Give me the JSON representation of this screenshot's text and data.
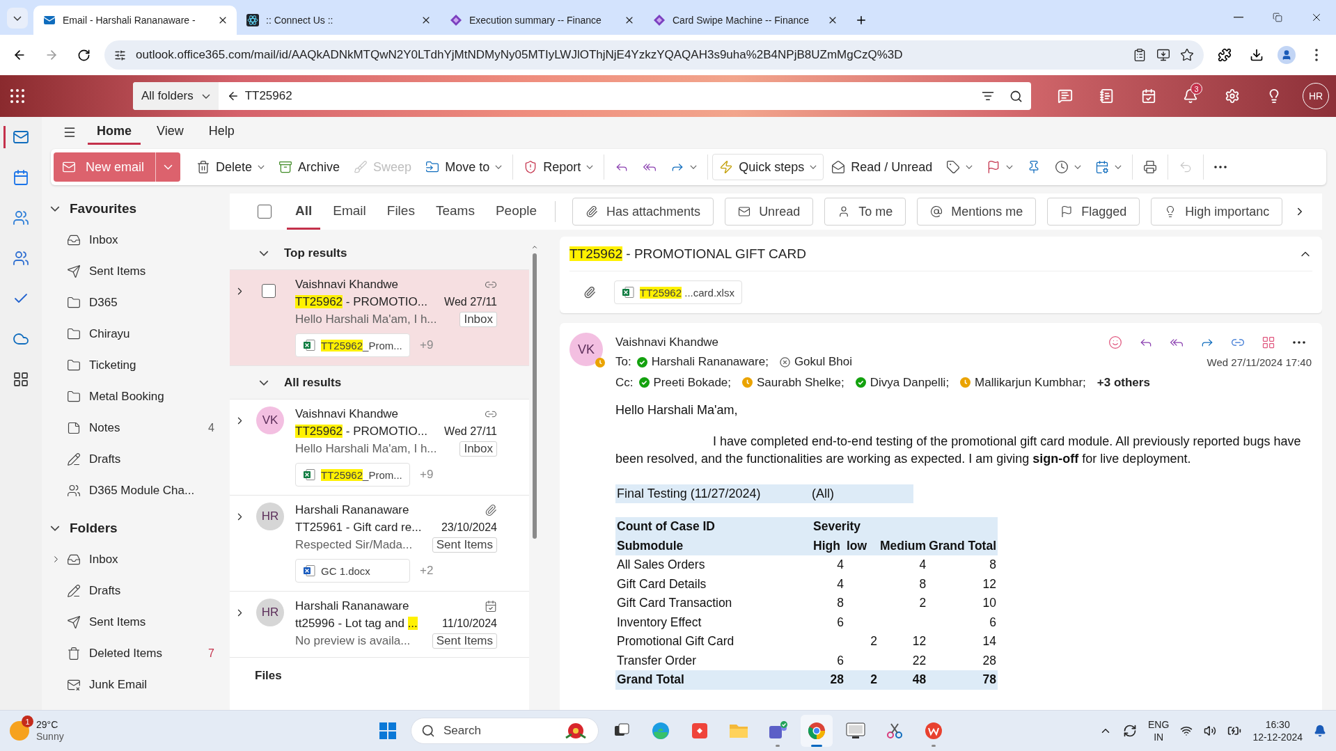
{
  "browser": {
    "tabs": [
      {
        "kind": "mail",
        "title": "Email - Harshali Rananaware -",
        "selected": true
      },
      {
        "kind": "atom",
        "title": ":: Connect Us ::",
        "selected": false
      },
      {
        "kind": "diamond",
        "title": "Execution summary -- Finance",
        "selected": false
      },
      {
        "kind": "diamond",
        "title": "Card Swipe Machine -- Finance",
        "selected": false
      }
    ],
    "url": "outlook.office365.com/mail/id/AAQkADNkMTQwN2Y0LTdhYjMtNDMyNy05MTIyLWJlOThjNjE4YzkzYQAQAH3s9uha%2B4NPjB8UZmMgCzQ%3D"
  },
  "header": {
    "scope": "All folders",
    "search": "TT25962",
    "notifications": "3",
    "avatar": "HR"
  },
  "rail": [
    {
      "kind": "mail",
      "selected": true
    },
    {
      "kind": "calendar",
      "selected": false
    },
    {
      "kind": "people",
      "selected": false
    },
    {
      "kind": "groups",
      "selected": false
    },
    {
      "kind": "todo",
      "selected": false
    },
    {
      "kind": "cloud",
      "selected": false
    },
    {
      "kind": "apps",
      "selected": false
    }
  ],
  "ribbon": {
    "tabs": [
      {
        "label": "Home",
        "selected": true
      },
      {
        "label": "View",
        "selected": false
      },
      {
        "label": "Help",
        "selected": false
      }
    ],
    "new_email": "New email",
    "groups": [
      [
        {
          "kind": "delete",
          "label": "Delete",
          "dropdown": true,
          "disabled": false
        },
        {
          "kind": "archive",
          "label": "Archive",
          "dropdown": false,
          "disabled": false
        },
        {
          "kind": "sweep",
          "label": "Sweep",
          "dropdown": false,
          "disabled": true
        },
        {
          "kind": "move",
          "label": "Move to",
          "dropdown": true,
          "disabled": false
        }
      ],
      [
        {
          "kind": "report",
          "label": "Report",
          "dropdown": true,
          "disabled": false
        }
      ],
      [
        {
          "kind": "reply",
          "dropdown": false,
          "disabled": false
        },
        {
          "kind": "reply_all",
          "dropdown": false,
          "disabled": false
        },
        {
          "kind": "forward",
          "dropdown": true,
          "disabled": false
        }
      ],
      [
        {
          "kind": "quick_steps",
          "label": "Quick steps",
          "dropdown": true,
          "disabled": false
        },
        {
          "kind": "read",
          "label": "Read / Unread",
          "dropdown": false,
          "disabled": false
        },
        {
          "kind": "tag",
          "dropdown": true,
          "disabled": false
        },
        {
          "kind": "flag",
          "dropdown": true,
          "disabled": false
        },
        {
          "kind": "pin",
          "dropdown": false,
          "disabled": false
        },
        {
          "kind": "snooze",
          "dropdown": true,
          "disabled": false
        },
        {
          "kind": "rules",
          "dropdown": true,
          "disabled": false
        }
      ],
      [
        {
          "kind": "print",
          "dropdown": false,
          "disabled": false
        }
      ],
      [
        {
          "kind": "undo",
          "dropdown": false,
          "disabled": true
        }
      ],
      [
        {
          "kind": "more",
          "dropdown": false,
          "disabled": false
        }
      ]
    ]
  },
  "favourites": {
    "title": "Favourites",
    "expanded": true,
    "items": [
      {
        "kind": "inbox",
        "label": "Inbox"
      },
      {
        "kind": "sent",
        "label": "Sent Items"
      },
      {
        "kind": "folder",
        "label": "D365"
      },
      {
        "kind": "folder",
        "label": "Chirayu"
      },
      {
        "kind": "folder",
        "label": "Ticketing"
      },
      {
        "kind": "folder",
        "label": "Metal Booking"
      },
      {
        "kind": "notes",
        "label": "Notes",
        "count": {
          "text": "4",
          "unread": false
        }
      },
      {
        "kind": "drafts",
        "label": "Drafts"
      },
      {
        "kind": "group",
        "label": "D365 Module Cha..."
      }
    ]
  },
  "folders": {
    "title": "Folders",
    "expanded": true,
    "items": [
      {
        "kind": "inbox",
        "label": "Inbox",
        "expandable": true
      },
      {
        "kind": "drafts",
        "label": "Drafts",
        "expandable": false
      },
      {
        "kind": "sent",
        "label": "Sent Items",
        "expandable": false
      },
      {
        "kind": "deleted",
        "label": "Deleted Items",
        "expandable": false,
        "count": {
          "text": "7",
          "unread": true
        }
      },
      {
        "kind": "junk",
        "label": "Junk Email",
        "expandable": false
      }
    ]
  },
  "filter_bar": {
    "select_all": false,
    "tabs": [
      {
        "label": "All",
        "selected": true
      },
      {
        "label": "Email",
        "selected": false
      },
      {
        "label": "Files",
        "selected": false
      },
      {
        "label": "Teams",
        "selected": false
      },
      {
        "label": "People",
        "selected": false
      }
    ],
    "chips": [
      {
        "kind": "attachment",
        "label": "Has attachments"
      },
      {
        "kind": "unread",
        "label": "Unread"
      },
      {
        "kind": "person",
        "label": "To me"
      },
      {
        "kind": "mention",
        "label": "Mentions me"
      },
      {
        "kind": "flag",
        "label": "Flagged"
      },
      {
        "kind": "importance",
        "label": "High importanc"
      }
    ]
  },
  "results": [
    {
      "title": "Top results",
      "expanded": true,
      "messages": [
        {
          "lead": {
            "kind": "checkbox",
            "checked": false
          },
          "selected": true,
          "sender": "Vaishnavi Khandwe",
          "status": {
            "kind": "link"
          },
          "subject": [
            {
              "text": "TT25962",
              "highlighted": true
            },
            {
              "text": " - PROMOTIO...",
              "highlighted": false
            }
          ],
          "date": "Wed 27/11",
          "preview": "Hello Harshali Ma'am, I h...",
          "folder": "Inbox",
          "attachment": {
            "kind": "excel",
            "name": [
              {
                "text": "TT25962",
                "highlighted": true
              },
              {
                "text": "_Prom...",
                "highlighted": false
              }
            ],
            "more": "+9"
          }
        }
      ]
    },
    {
      "title": "All results",
      "expanded": true,
      "messages": [
        {
          "lead": {
            "kind": "avatar",
            "initials": "VK",
            "color": "#f3bfe1"
          },
          "selected": false,
          "sender": "Vaishnavi Khandwe",
          "status": {
            "kind": "link"
          },
          "subject": [
            {
              "text": "TT25962",
              "highlighted": true
            },
            {
              "text": " - PROMOTIO...",
              "highlighted": false
            }
          ],
          "date": "Wed 27/11",
          "preview": "Hello Harshali Ma'am, I h...",
          "folder": "Inbox",
          "attachment": {
            "kind": "excel",
            "name": [
              {
                "text": "TT25962",
                "highlighted": true
              },
              {
                "text": "_Prom...",
                "highlighted": false
              }
            ],
            "more": "+9"
          }
        },
        {
          "lead": {
            "kind": "avatar",
            "initials": "HR",
            "color": "#d6d6d6"
          },
          "selected": false,
          "sender": "Harshali Rananaware",
          "status": {
            "kind": "paperclip"
          },
          "subject": [
            {
              "text": "TT25961 - Gift card re...",
              "highlighted": false
            }
          ],
          "date": "23/10/2024",
          "preview": "Respected Sir/Mada...",
          "folder": "Sent Items",
          "attachment": {
            "kind": "word",
            "name": [
              {
                "text": "GC 1.docx",
                "highlighted": false
              }
            ],
            "more": "+2"
          }
        },
        {
          "lead": {
            "kind": "avatar",
            "initials": "HR",
            "color": "#d6d6d6"
          },
          "selected": false,
          "sender": "Harshali Rananaware",
          "status": {
            "kind": "calendar"
          },
          "subject": [
            {
              "text": "tt25996 - Lot tag and ",
              "highlighted": false
            },
            {
              "text": "...",
              "highlighted": true
            }
          ],
          "date": "11/10/2024",
          "preview": "No preview is availa...",
          "folder": "Sent Items"
        }
      ]
    }
  ],
  "files_heading": "Files",
  "reading": {
    "subject": [
      {
        "text": "TT25962",
        "highlighted": true
      },
      {
        "text": " - PROMOTIONAL GIFT CARD",
        "highlighted": false
      }
    ],
    "attachments": [
      {
        "kind": "excel",
        "name": [
          {
            "text": "TT25962",
            "highlighted": true
          },
          {
            "text": " ...card.xlsx",
            "highlighted": false
          }
        ]
      }
    ],
    "message": {
      "avatar": {
        "initials": "VK",
        "color": "#f3bfe1"
      },
      "presence": {
        "kind": "away"
      },
      "sender": "Vaishnavi Khandwe",
      "to_label": "To:",
      "to": [
        {
          "name": "Harshali Rananaware;",
          "presence": {
            "kind": "available"
          }
        },
        {
          "name": "Gokul Bhoi",
          "presence": {
            "kind": "offline"
          }
        }
      ],
      "cc_label": "Cc:",
      "cc": [
        {
          "name": "Preeti Bokade;",
          "presence": {
            "kind": "available"
          }
        },
        {
          "name": "Saurabh Shelke;",
          "presence": {
            "kind": "away"
          }
        },
        {
          "name": "Divya Danpelli;",
          "presence": {
            "kind": "available"
          }
        },
        {
          "name": "Mallikarjun Kumbhar;",
          "presence": {
            "kind": "away"
          }
        }
      ],
      "others": "+3 others",
      "date": "Wed 27/11/2024 17:40",
      "greeting": "Hello Harshali Ma'am,",
      "paragraph": "I have completed end-to-end testing of the promotional gift card module. All previously reported bugs have been resolved, and the functionalities are working as expected. I am giving **sign-off** for live deployment.",
      "filter": {
        "label": "Final Testing (11/27/2024)",
        "value": "(All)"
      },
      "pivot": {
        "header_top": [
          "Count of Case ID",
          "Severity"
        ],
        "header": [
          "Submodule",
          "High",
          "low",
          "Medium",
          "Grand Total"
        ],
        "rows": [
          [
            "All Sales Orders",
            "4",
            null,
            "4",
            "8"
          ],
          [
            "Gift Card Details",
            "4",
            null,
            "8",
            "12"
          ],
          [
            "Gift Card Transaction",
            "8",
            null,
            "2",
            "10"
          ],
          [
            "Inventory Effect",
            "6",
            null,
            null,
            "6"
          ],
          [
            "Promotional Gift Card",
            null,
            "2",
            "12",
            "14"
          ],
          [
            "Transfer Order",
            "6",
            null,
            "22",
            "28"
          ]
        ],
        "total": [
          "Grand Total",
          "28",
          "2",
          "48",
          "78"
        ]
      }
    }
  },
  "taskbar": {
    "weather": {
      "temp": "29°C",
      "condition": "Sunny",
      "badge": "1"
    },
    "search": "Search",
    "apps": [
      {
        "kind": "taskview",
        "running": false,
        "active": false
      },
      {
        "kind": "edge",
        "running": false,
        "active": false
      },
      {
        "kind": "remote",
        "running": false,
        "active": false
      },
      {
        "kind": "explorer",
        "running": false,
        "active": false
      },
      {
        "kind": "teams",
        "running": true,
        "active": false
      },
      {
        "kind": "chrome",
        "running": true,
        "active": true
      },
      {
        "kind": "vnc",
        "running": false,
        "active": false
      },
      {
        "kind": "snip",
        "running": false,
        "active": false
      },
      {
        "kind": "wps",
        "running": true,
        "active": false
      }
    ],
    "lang": "ENG",
    "region": "IN",
    "time": "16:30",
    "date": "12-12-2024"
  }
}
